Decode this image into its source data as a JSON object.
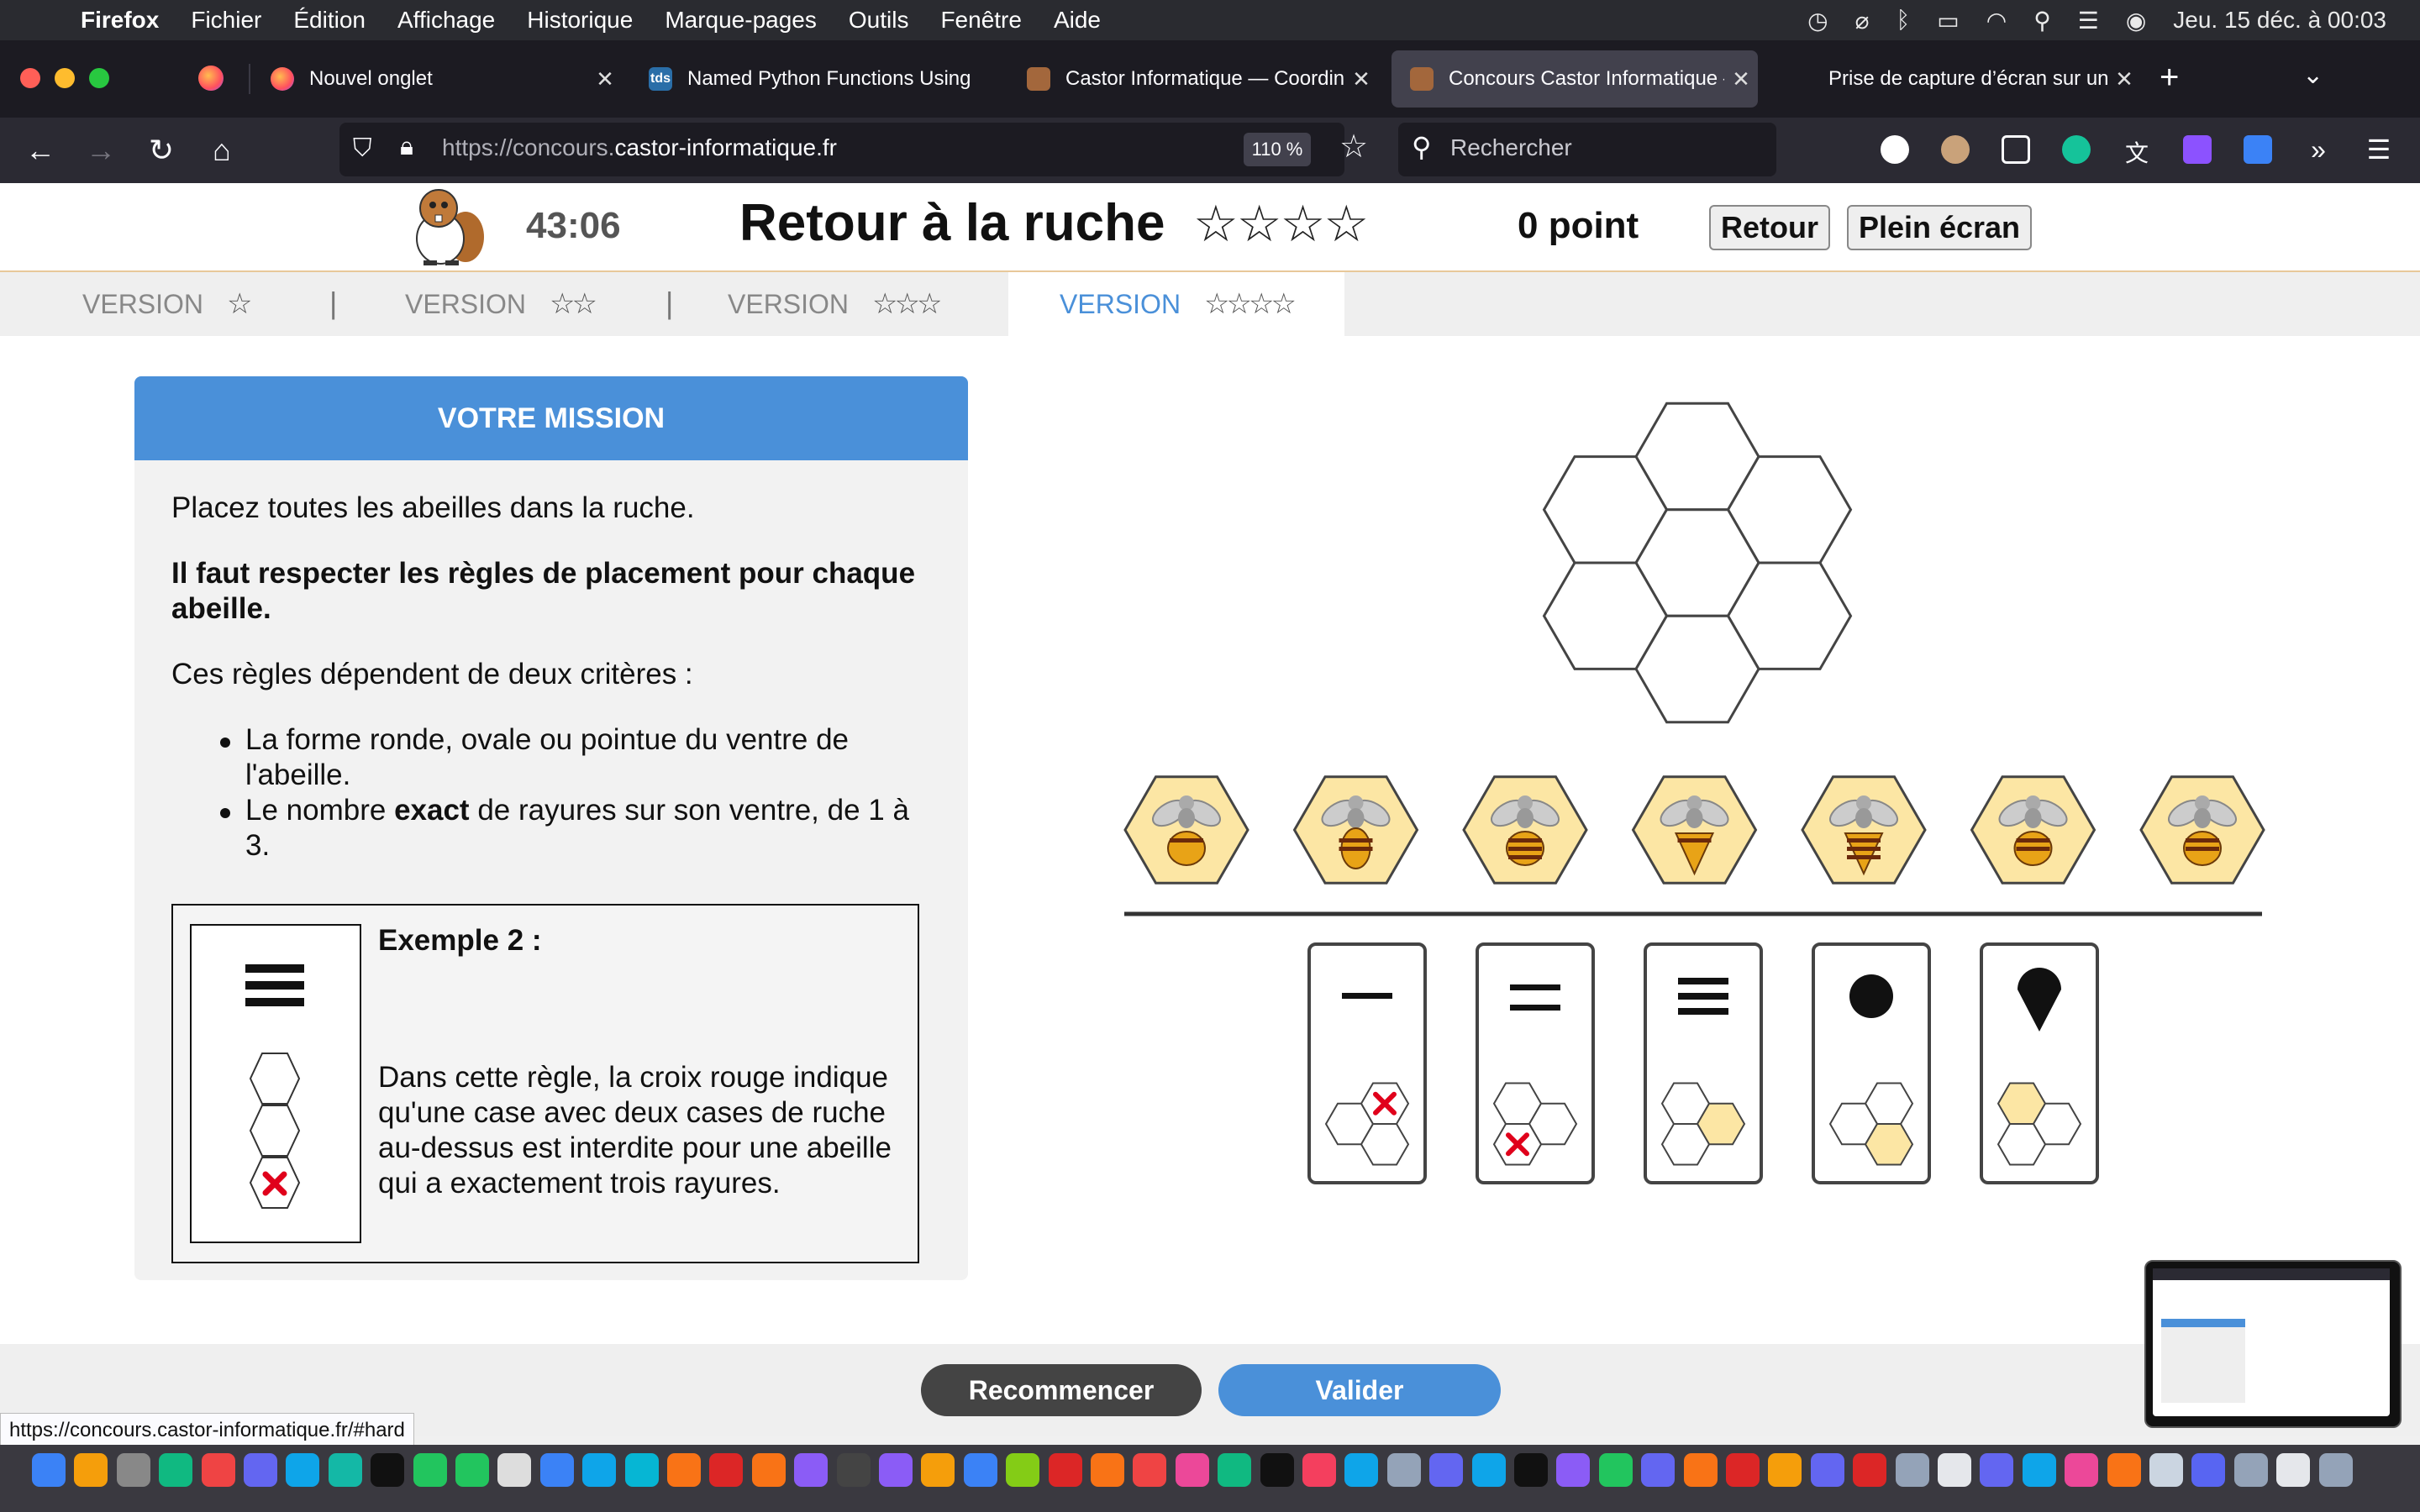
{
  "menubar": {
    "apple": "",
    "items": [
      "Firefox",
      "Fichier",
      "Édition",
      "Affichage",
      "Historique",
      "Marque-pages",
      "Outils",
      "Fenêtre",
      "Aide"
    ],
    "datetime": "Jeu. 15 déc. à  00:03"
  },
  "tabs": [
    {
      "title": "Nouvel onglet",
      "icon": "firefox-icon",
      "color": "#ff7139"
    },
    {
      "title": "Named Python Functions Using",
      "icon": "tds-icon",
      "color": "#2a6ea8"
    },
    {
      "title": "Castor Informatique — Coordina",
      "icon": "castor-icon",
      "color": "#a3673c"
    },
    {
      "title": "Concours Castor Informatique –",
      "icon": "castor-icon",
      "color": "#a3673c"
    },
    {
      "title": "Prise de capture d’écran sur un",
      "icon": "apple-icon",
      "color": "#888888"
    }
  ],
  "address": {
    "url": "https://concours.castor-informatique.fr",
    "url_prefix": "https://concours.",
    "url_domain": "castor-informatique.fr",
    "zoom": "110 %",
    "search_placeholder": "Rechercher"
  },
  "task": {
    "timer": "43:06",
    "title": "Retour à la ruche",
    "stars": "☆☆☆☆",
    "score": "0 point",
    "back_label": "Retour",
    "fullscreen_label": "Plein écran"
  },
  "versions": [
    {
      "label": "VERSION",
      "stars": "☆"
    },
    {
      "label": "VERSION",
      "stars": "☆☆"
    },
    {
      "label": "VERSION",
      "stars": "☆☆☆"
    },
    {
      "label": "VERSION",
      "stars": "☆☆☆☆"
    }
  ],
  "version_separator": "|",
  "mission": {
    "header": "VOTRE MISSION",
    "p1": "Placez toutes les abeilles dans la ruche.",
    "p2": "Il faut respecter les règles de placement pour chaque abeille.",
    "p3": "Ces règles dépendent de deux critères :",
    "bullet1": "La forme ronde, ovale ou pointue du ventre de l'abeille.",
    "bullet2_pre": "Le nombre ",
    "bullet2_bold": "exact",
    "bullet2_post": " de rayures sur son ventre, de 1 à 3.",
    "example_title": "Exemple 2 :",
    "example_text": "Dans cette règle, la croix rouge indique qu'une case avec deux cases de ruche au-dessus est interdite pour une abeille qui a exactement trois rayures."
  },
  "board": {
    "hive_cells": 7,
    "bee_count": 7,
    "rule_cards": 5,
    "hex_fill": "#fce6a4",
    "forbidden_color": "#e0001b"
  },
  "footer": {
    "restart_label": "Recommencer",
    "validate_label": "Valider",
    "restart_color": "#444444",
    "validate_color": "#4a90d9",
    "status_url": "https://concours.castor-informatique.fr/#hard"
  }
}
